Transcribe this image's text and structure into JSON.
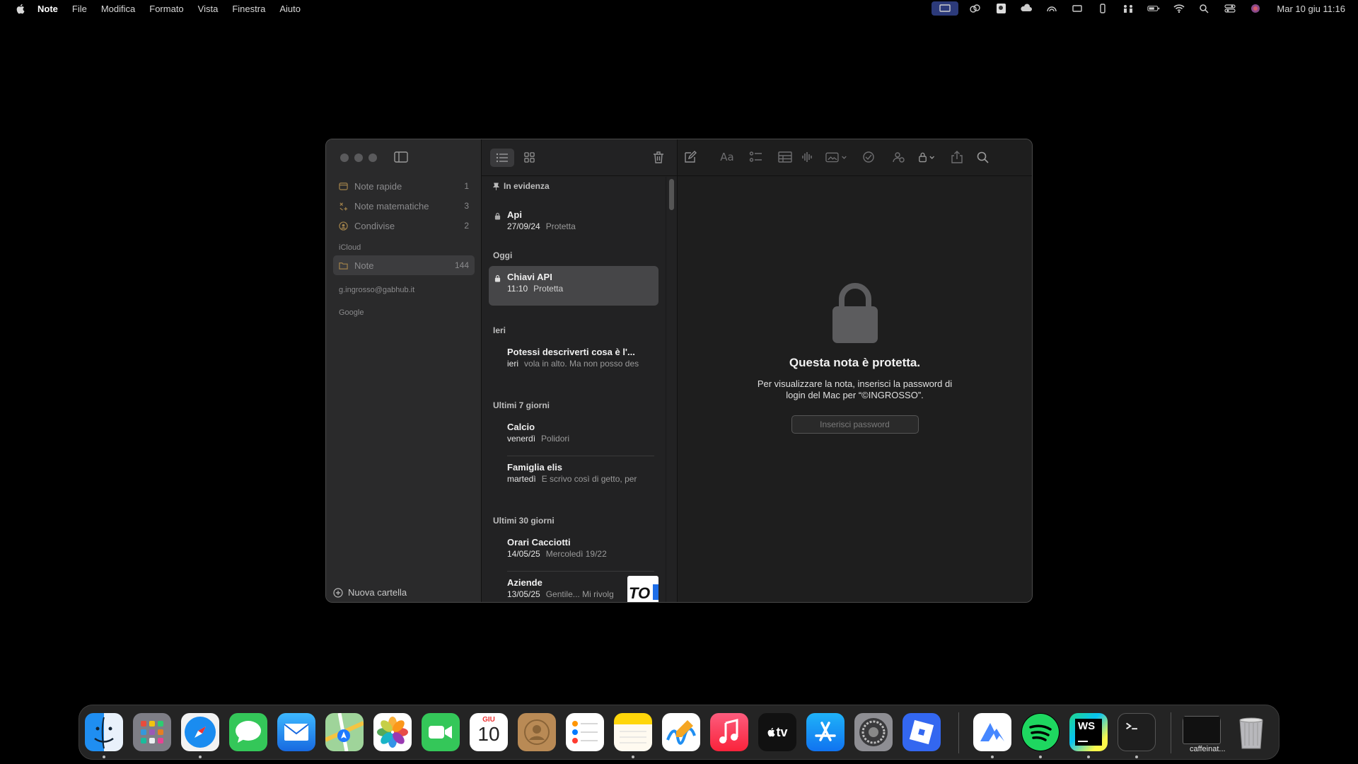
{
  "menubar": {
    "app": "Note",
    "items": [
      "File",
      "Modifica",
      "Formato",
      "Vista",
      "Finestra",
      "Aiuto"
    ],
    "clock": "Mar 10 giu  11:16"
  },
  "sidebar": {
    "smart_folders": [
      {
        "label": "Note rapide",
        "count": "1",
        "icon": "quick-note-icon"
      },
      {
        "label": "Note matematiche",
        "count": "3",
        "icon": "math-icon"
      },
      {
        "label": "Condivise",
        "count": "2",
        "icon": "shared-icon"
      }
    ],
    "icloud_header": "iCloud",
    "icloud_folders": [
      {
        "label": "Note",
        "count": "144",
        "icon": "folder-icon",
        "selected": true
      }
    ],
    "accounts": [
      "g.ingrosso@gabhub.it",
      "Google"
    ],
    "new_folder": "Nuova cartella"
  },
  "note_list": {
    "pinned_header": "In evidenza",
    "groups": [
      {
        "title": "Oggi"
      },
      {
        "title": "Ieri"
      },
      {
        "title": "Ultimi 7 giorni"
      },
      {
        "title": "Ultimi 30 giorni"
      }
    ],
    "pinned": [
      {
        "title": "Api",
        "date": "27/09/24",
        "preview": "Protetta",
        "locked": true
      }
    ],
    "today": [
      {
        "title": "Chiavi API",
        "date": "11:10",
        "preview": "Protetta",
        "locked": true,
        "selected": true
      }
    ],
    "yesterday": [
      {
        "title": "Potessi descriverti cosa è l'...",
        "date": "ieri",
        "preview": "vola in alto. Ma non posso des"
      }
    ],
    "last7": [
      {
        "title": "Calcio",
        "date": "venerdì",
        "preview": "Polidori"
      },
      {
        "title": "Famiglia elis",
        "date": "martedì",
        "preview": "E scrivo così di getto, per"
      }
    ],
    "last30": [
      {
        "title": "Orari Cacciotti",
        "date": "14/05/25",
        "preview": "Mercoledì 19/22"
      },
      {
        "title": "Aziende",
        "date": "13/05/25",
        "preview": "Gentile... Mi rivolg"
      }
    ],
    "thumb_text": "TO"
  },
  "editor": {
    "locked_title": "Questa nota è protetta.",
    "locked_desc": "Per visualizzare la nota, inserisci la password di login del Mac per “©INGROSSO”.",
    "password_placeholder": "Inserisci password"
  },
  "dock": {
    "apps": [
      "Finder",
      "Launchpad",
      "Safari",
      "Messaggi",
      "Mail",
      "Mappe",
      "Foto",
      "FaceTime",
      "Calendario",
      "Contatti",
      "Promemoria",
      "Note",
      "Freeform",
      "Musica",
      "TV",
      "App Store",
      "Impostazioni di Sistema",
      "Roblox",
      "NordVPN",
      "Spotify",
      "WebStorm",
      "Terminale"
    ],
    "calendar_month": "GIU",
    "calendar_day": "10",
    "tv_label": "tv",
    "ws_label": "WS",
    "minimized_label": "caffeinat..."
  },
  "colors": {
    "accent_folder": "#a0814a",
    "window_bg": "#1e1e1e",
    "sidebar_bg": "#2a2a2b",
    "selected_note": "#464648"
  }
}
